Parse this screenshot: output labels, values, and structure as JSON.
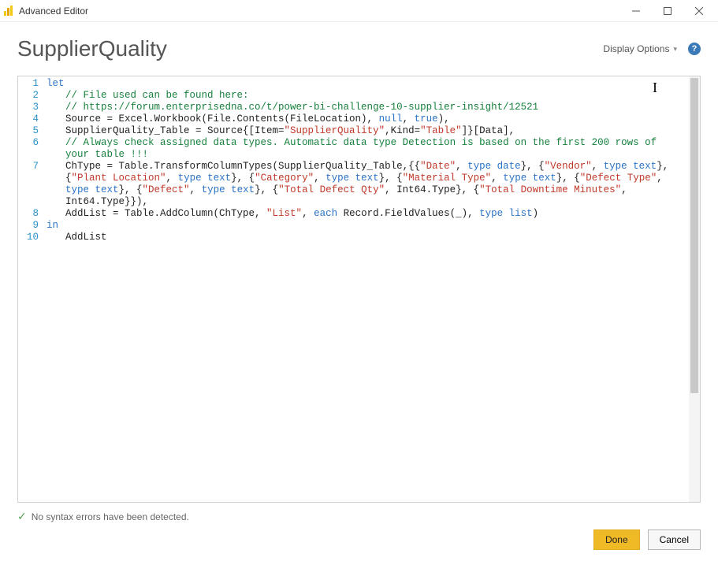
{
  "titlebar": {
    "title": "Advanced Editor"
  },
  "header": {
    "queryName": "SupplierQuality",
    "displayOptions": "Display Options"
  },
  "gutter": {
    "l1": "1",
    "l2": "2",
    "l3": "3",
    "l4": "4",
    "l5": "5",
    "l6": "6",
    "l7": "7",
    "l8": "8",
    "l9": "9",
    "l10": "10"
  },
  "code": {
    "l1_kw": "let",
    "l2_cmt": "// File used can be found here:",
    "l3_cmt": "// https://forum.enterprisedna.co/t/power-bi-challenge-10-supplier-insight/12521",
    "l4_a": "Source = Excel.Workbook(File.Contents(FileLocation), ",
    "l4_null": "null",
    "l4_b": ", ",
    "l4_true": "true",
    "l4_c": "),",
    "l5_a": "SupplierQuality_Table = Source{[Item=",
    "l5_s1": "\"SupplierQuality\"",
    "l5_b": ",Kind=",
    "l5_s2": "\"Table\"",
    "l5_c": "]}[Data],",
    "l6_cmt": "// Always check assigned data types. Automatic data type Detection is based on the first 200 rows of your table !!!",
    "l7_a": "ChType = Table.TransformColumnTypes(SupplierQuality_Table,{{",
    "l7_s1": "\"Date\"",
    "l7_b": ", ",
    "l7_t1": "type date",
    "l7_c": "}, {",
    "l7_s2": "\"Vendor\"",
    "l7_d": ", ",
    "l7_t2": "type text",
    "l7_e": "}, {",
    "l7_s3": "\"Plant Location\"",
    "l7_f": ", ",
    "l7_t3": "type text",
    "l7_g": "}, {",
    "l7_s4": "\"Category\"",
    "l7_h": ", ",
    "l7_t4": "type text",
    "l7_i": "}, {",
    "l7_s5": "\"Material Type\"",
    "l7_j": ", ",
    "l7_t5": "type text",
    "l7_k": "}, {",
    "l7_s6": "\"Defect Type\"",
    "l7_l": ", ",
    "l7_t6": "type text",
    "l7_m": "}, {",
    "l7_s7": "\"Defect\"",
    "l7_n": ", ",
    "l7_t7": "type text",
    "l7_o": "}, {",
    "l7_s8": "\"Total Defect Qty\"",
    "l7_p": ", Int64.Type}, {",
    "l7_s9": "\"Total Downtime Minutes\"",
    "l7_q": ", Int64.Type}}),",
    "l8_a": "AddList = Table.AddColumn(ChType, ",
    "l8_s1": "\"List\"",
    "l8_b": ", ",
    "l8_each": "each",
    "l8_c": " Record.FieldValues(_), ",
    "l8_t1": "type list",
    "l8_d": ")",
    "l9_kw": "in",
    "l10_a": "AddList"
  },
  "status": {
    "message": "No syntax errors have been detected."
  },
  "footer": {
    "done": "Done",
    "cancel": "Cancel"
  },
  "help": {
    "glyph": "?"
  },
  "cursor": {
    "glyph": "I"
  }
}
